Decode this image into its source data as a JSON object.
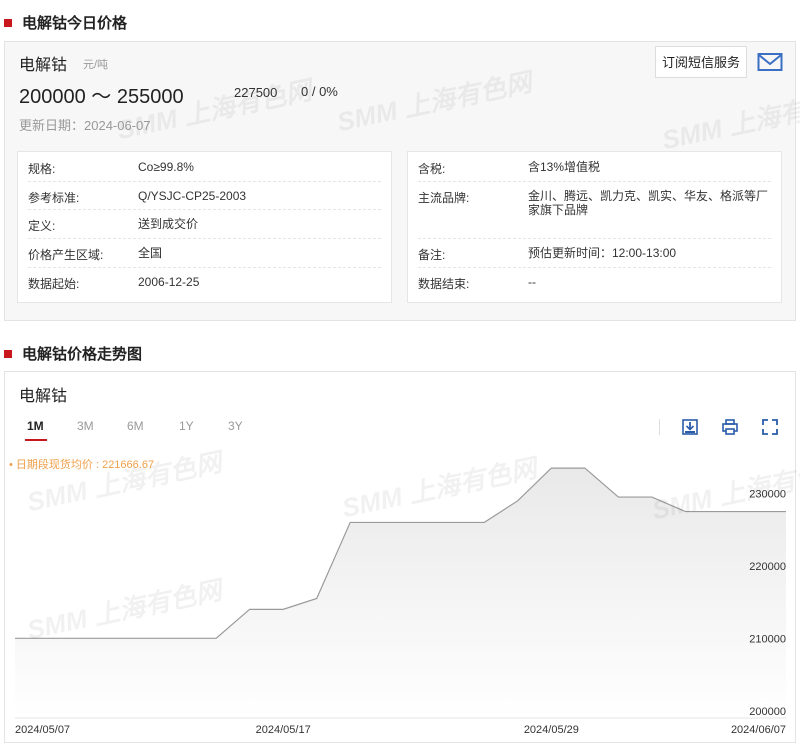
{
  "section1": {
    "title": "电解钴今日价格"
  },
  "price": {
    "name": "电解钴",
    "unit": "元/吨",
    "range": "200000 ～ 255000",
    "average": "227500",
    "change": "0 / 0%",
    "update_date": "更新日期：2024-06-07",
    "subscribe_label": "订阅短信服务",
    "watermark": "SMM 上海有色网"
  },
  "spec_left": [
    {
      "key": "规格:",
      "value": "Co≥99.8%"
    },
    {
      "key": "参考标准:",
      "value": "Q/YSJC-CP25-2003"
    },
    {
      "key": "定义:",
      "value": "送到成交价"
    },
    {
      "key": "价格产生区域:",
      "value": "全国"
    },
    {
      "key": "数据起始:",
      "value": "2006-12-25"
    }
  ],
  "spec_right": [
    {
      "key": "含税:",
      "value": "含13%增值税"
    },
    {
      "key": "主流品牌:",
      "value": "金川、腾远、凯力克、凯实、华友、格派等厂家旗下品牌"
    },
    {
      "key": "备注:",
      "value": "预估更新时间：12:00-13:00"
    },
    {
      "key": "数据结束:",
      "value": "--"
    }
  ],
  "section2": {
    "title": "电解钴价格走势图"
  },
  "chart_panel": {
    "name": "电解钴",
    "tabs": [
      "1M",
      "3M",
      "6M",
      "1Y",
      "3Y"
    ],
    "active_tab": "1M",
    "avg_label": "• 日期段现货均价 : 221666.67",
    "icons": [
      "download-icon",
      "print-icon",
      "fullscreen-icon"
    ]
  },
  "chart_data": {
    "type": "area",
    "title": "",
    "xlabel": "",
    "ylabel": "",
    "x": [
      "2024-05-07",
      "2024-05-08",
      "2024-05-09",
      "2024-05-10",
      "2024-05-13",
      "2024-05-14",
      "2024-05-15",
      "2024-05-16",
      "2024-05-17",
      "2024-05-20",
      "2024-05-21",
      "2024-05-22",
      "2024-05-23",
      "2024-05-24",
      "2024-05-27",
      "2024-05-28",
      "2024-05-29",
      "2024-05-30",
      "2024-05-31",
      "2024-06-03",
      "2024-06-04",
      "2024-06-05",
      "2024-06-06",
      "2024-06-07"
    ],
    "values": [
      210000,
      210000,
      210000,
      210000,
      210000,
      210000,
      210000,
      214000,
      214000,
      215500,
      226000,
      226000,
      226000,
      226000,
      226000,
      229000,
      233500,
      233500,
      229500,
      229500,
      227500,
      227500,
      227500,
      227500
    ],
    "x_tick_labels": [
      "2024/05/07",
      "2024/05/17",
      "2024/05/29",
      "2024/06/07"
    ],
    "y_ticks": [
      200000,
      210000,
      220000,
      230000
    ],
    "ylim": [
      199000,
      236000
    ],
    "grid": false,
    "fill_color": "#e9e9e9",
    "line_color": "#9a9a9a"
  }
}
